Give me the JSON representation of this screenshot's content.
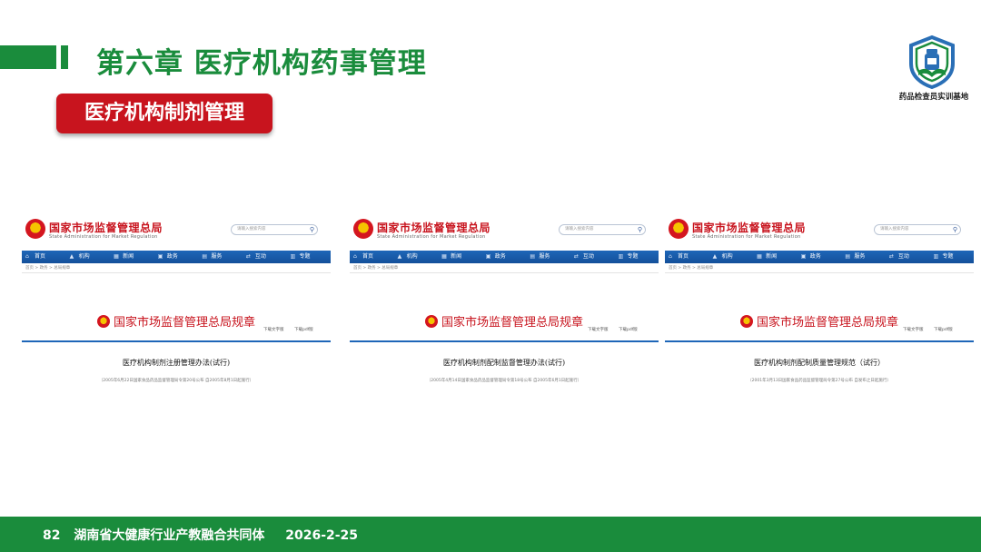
{
  "header": {
    "chapter_title": "第六章  医疗机构药事管理",
    "section_label": "医疗机构制剂管理",
    "logo_text": "药品检查员实训基地",
    "accent_color": "#1a8c3c",
    "section_color": "#c8141e"
  },
  "site": {
    "name": "国家市场监督管理总局",
    "name_en": "State Administration for Market Regulation",
    "search_placeholder": "请输入搜索内容",
    "nav": [
      {
        "icon": "home-icon",
        "glyph": "⌂",
        "label": "首页"
      },
      {
        "icon": "building-icon",
        "glyph": "▲",
        "label": "机构"
      },
      {
        "icon": "news-icon",
        "glyph": "▦",
        "label": "新闻"
      },
      {
        "icon": "gov-icon",
        "glyph": "▣",
        "label": "政务"
      },
      {
        "icon": "service-icon",
        "glyph": "▤",
        "label": "服务"
      },
      {
        "icon": "interact-icon",
        "glyph": "⇄",
        "label": "互动"
      },
      {
        "icon": "topic-icon",
        "glyph": "▥",
        "label": "专题"
      }
    ],
    "breadcrumb": "首页 > 政务 > 总局规章",
    "rule_heading": "国家市场监督管理总局规章",
    "download_text": "下载文字版",
    "download_pdf": "下载pdf版"
  },
  "cards": [
    {
      "doc_title": "医疗机构制剂注册管理办法(试行)",
      "doc_sub": "（2005年6月22日国家食品药品监督管理局令第20号公布  自2005年8月1日起施行）"
    },
    {
      "doc_title": "医疗机构制剂配制监督管理办法(试行)",
      "doc_sub": "（2005年4月14日国家食品药品监督管理局令第18号公布  自2005年6月1日起施行）"
    },
    {
      "doc_title": "医疗机构制剂配制质量管理规范（试行）",
      "doc_sub": "（2001年3月13日国家食品药品监督管理局令第27号公布  自发布之日起施行）"
    }
  ],
  "footer": {
    "page_number": "82",
    "org": "湖南省大健康行业产教融合共同体",
    "date": "2026-2-25"
  }
}
